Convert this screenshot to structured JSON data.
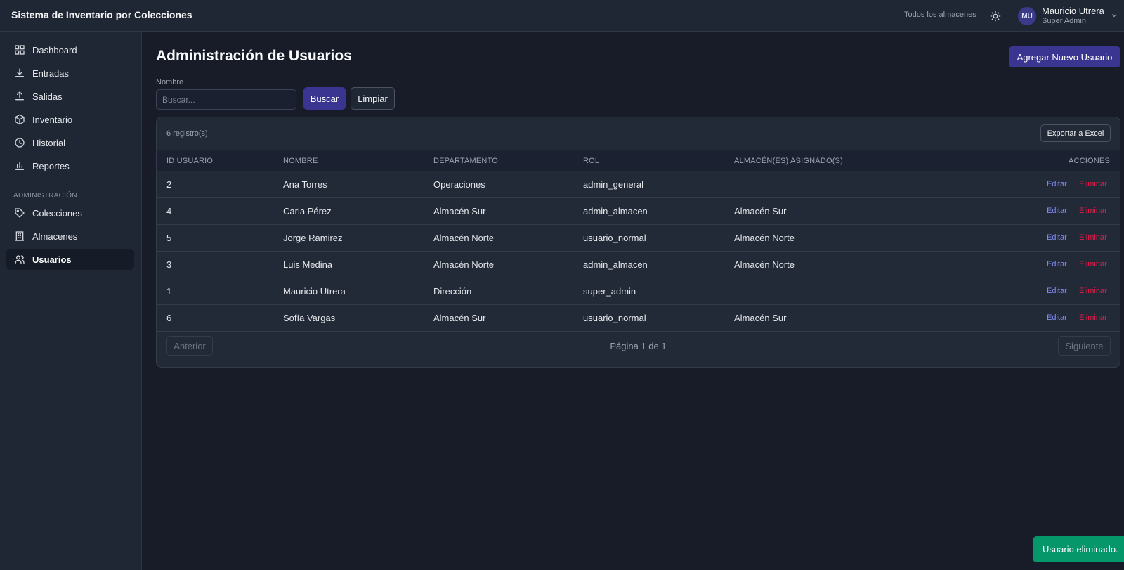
{
  "app": {
    "title": "Sistema de Inventario por Colecciones"
  },
  "header": {
    "warehouse_selector": "Todos los almacenes",
    "user": {
      "initials": "MU",
      "name": "Mauricio Utrera",
      "role": "Super Admin"
    }
  },
  "sidebar": {
    "items": [
      {
        "label": "Dashboard",
        "icon": "grid-icon"
      },
      {
        "label": "Entradas",
        "icon": "download-icon"
      },
      {
        "label": "Salidas",
        "icon": "upload-icon"
      },
      {
        "label": "Inventario",
        "icon": "box-icon"
      },
      {
        "label": "Historial",
        "icon": "clock-icon"
      },
      {
        "label": "Reportes",
        "icon": "bar-chart-icon"
      }
    ],
    "section_label": "ADMINISTRACIÓN",
    "admin_items": [
      {
        "label": "Colecciones",
        "icon": "tag-icon"
      },
      {
        "label": "Almacenes",
        "icon": "building-icon"
      },
      {
        "label": "Usuarios",
        "icon": "users-icon",
        "active": true
      }
    ]
  },
  "main": {
    "title": "Administración de Usuarios",
    "add_button": "Agregar Nuevo Usuario",
    "filter": {
      "label": "Nombre",
      "placeholder": "Buscar...",
      "value": "",
      "search_button": "Buscar",
      "clear_button": "Limpiar"
    },
    "table": {
      "record_count": "6 registro(s)",
      "export_button": "Exportar a Excel",
      "columns": [
        "ID USUARIO",
        "NOMBRE",
        "DEPARTAMENTO",
        "ROL",
        "ALMACÉN(ES) ASIGNADO(S)",
        "ACCIONES"
      ],
      "rows": [
        {
          "id": "2",
          "name": "Ana Torres",
          "department": "Operaciones",
          "role": "admin_general",
          "warehouse": ""
        },
        {
          "id": "4",
          "name": "Carla Pérez",
          "department": "Almacén Sur",
          "role": "admin_almacen",
          "warehouse": "Almacén Sur"
        },
        {
          "id": "5",
          "name": "Jorge Ramirez",
          "department": "Almacén Norte",
          "role": "usuario_normal",
          "warehouse": "Almacén Norte"
        },
        {
          "id": "3",
          "name": "Luis Medina",
          "department": "Almacén Norte",
          "role": "admin_almacen",
          "warehouse": "Almacén Norte"
        },
        {
          "id": "1",
          "name": "Mauricio Utrera",
          "department": "Dirección",
          "role": "super_admin",
          "warehouse": ""
        },
        {
          "id": "6",
          "name": "Sofía Vargas",
          "department": "Almacén Sur",
          "role": "usuario_normal",
          "warehouse": "Almacén Sur"
        }
      ],
      "edit_label": "Editar",
      "delete_label": "Eliminar",
      "pagination": {
        "prev": "Anterior",
        "info": "Página 1 de 1",
        "next": "Siguiente"
      }
    }
  },
  "toast": {
    "message": "Usuario eliminado."
  },
  "colors": {
    "accent": "#3a3590",
    "danger": "#e11d48",
    "link": "#818cf8",
    "success": "#059669"
  }
}
